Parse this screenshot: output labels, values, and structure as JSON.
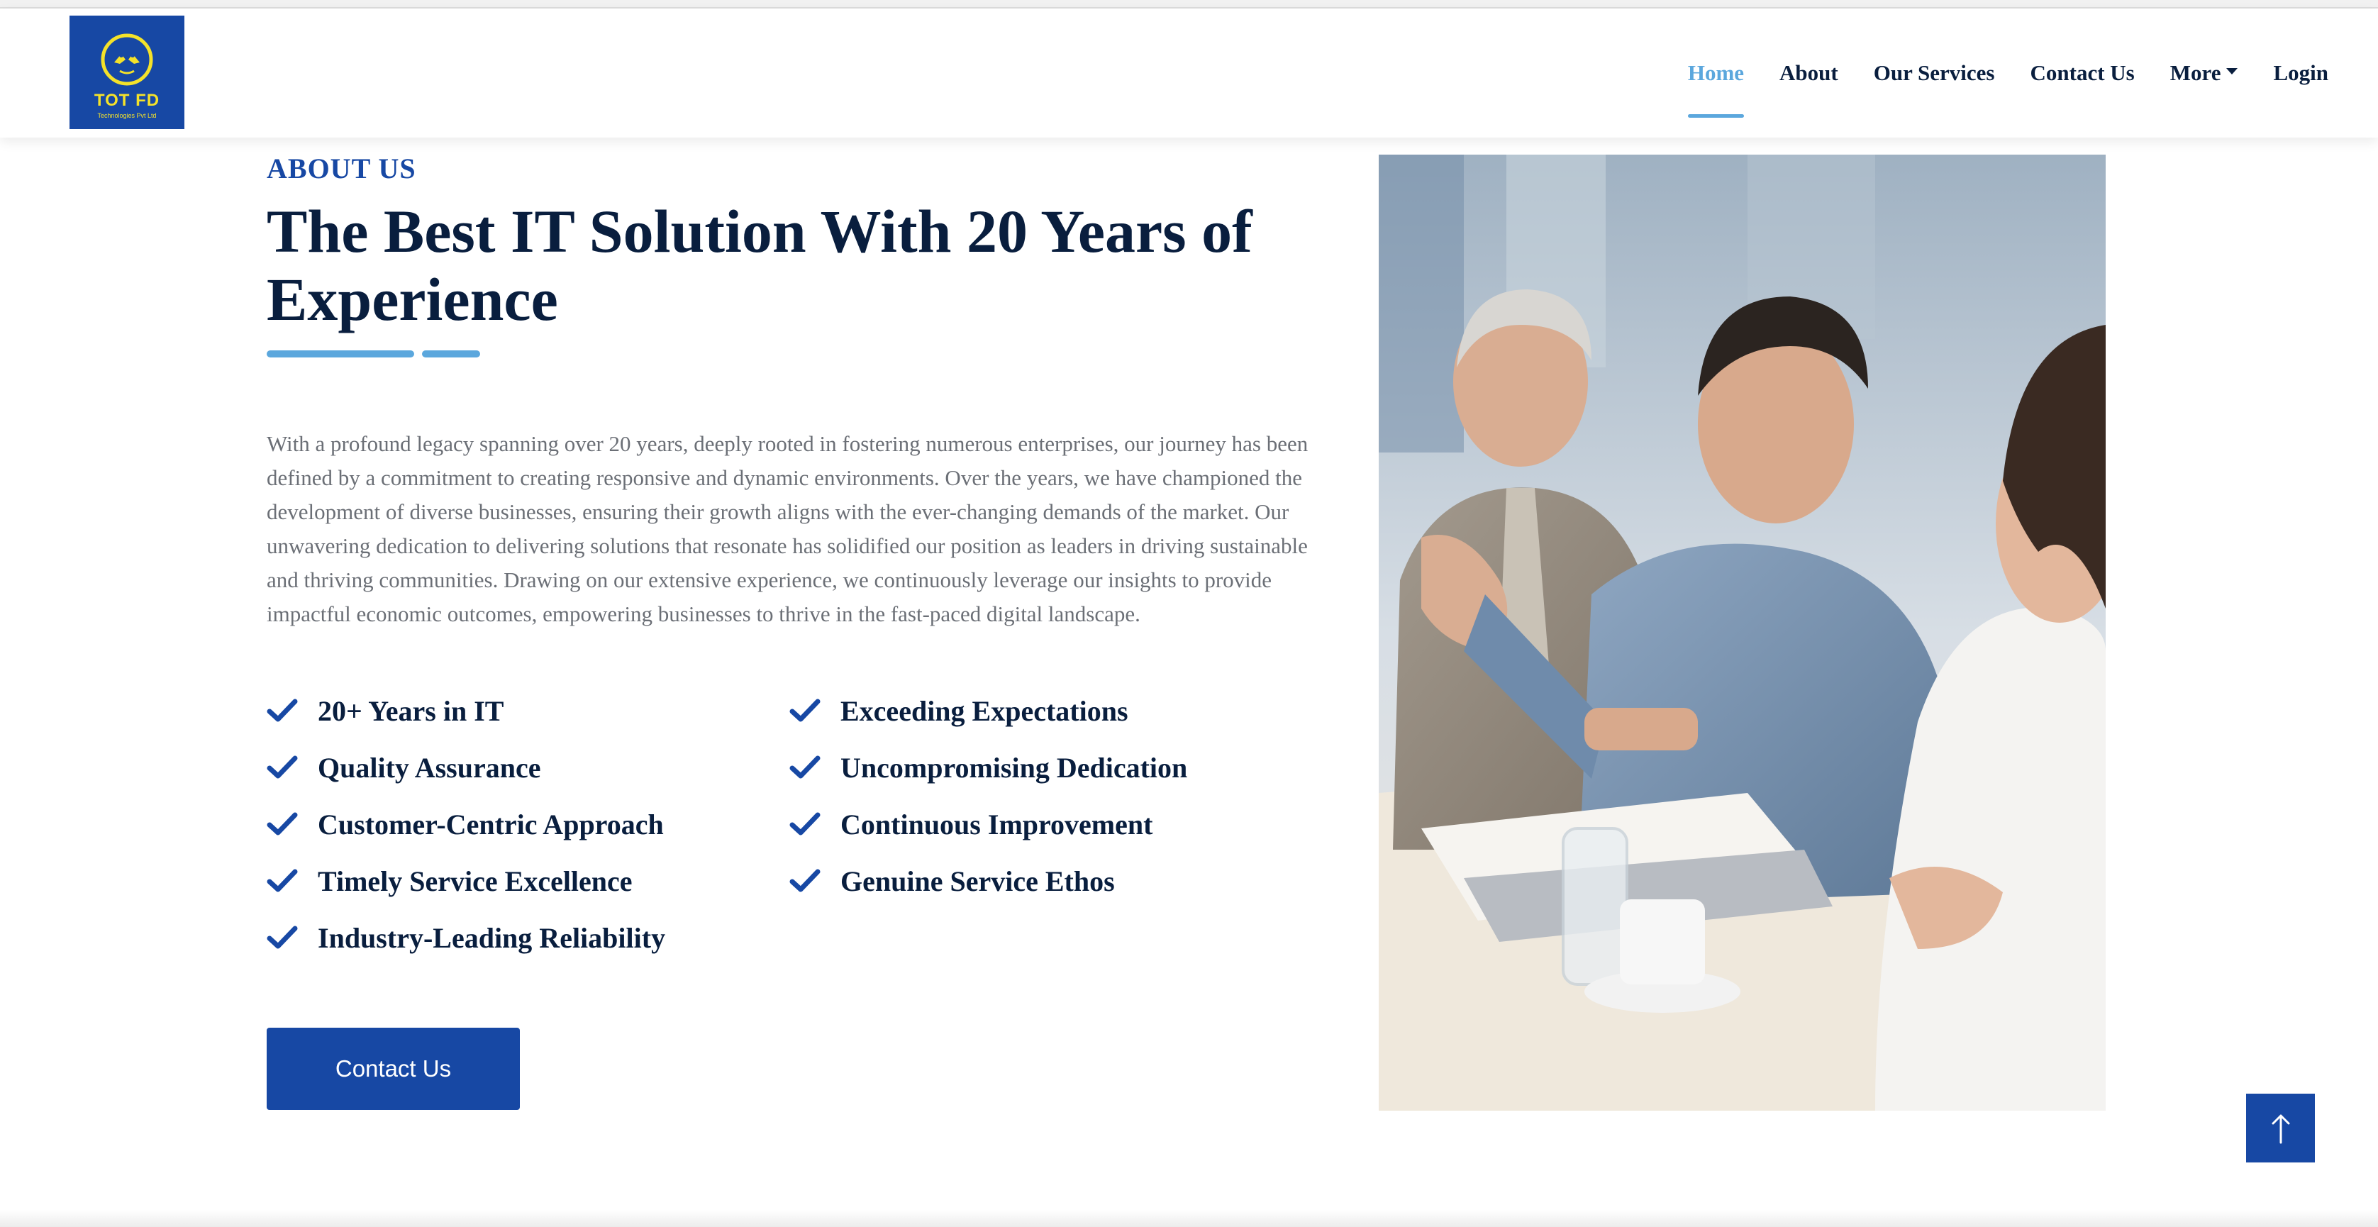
{
  "brand": {
    "name": "TOT FD",
    "tagline": "Technologies Pvt Ltd",
    "logo_bg": "#1748a4",
    "logo_fg": "#f4e22a"
  },
  "nav": {
    "items": [
      {
        "label": "Home",
        "active": true
      },
      {
        "label": "About",
        "active": false
      },
      {
        "label": "Our Services",
        "active": false
      },
      {
        "label": "Contact Us",
        "active": false
      },
      {
        "label": "More",
        "active": false,
        "dropdown": true
      },
      {
        "label": "Login",
        "active": false
      }
    ]
  },
  "about": {
    "label": "ABOUT US",
    "headline": "The Best IT Solution With 20 Years of Experience",
    "paragraph": "With a profound legacy spanning over 20 years, deeply rooted in fostering numerous enterprises, our journey has been defined by a commitment to creating responsive and dynamic environments. Over the years, we have championed the development of diverse businesses, ensuring their growth aligns with the ever-changing demands of the market. Our unwavering dedication to delivering solutions that resonate has solidified our position as leaders in driving sustainable and thriving communities. Drawing on our extensive experience, we continuously leverage our insights to provide impactful economic outcomes, empowering businesses to thrive in the fast-paced digital landscape.",
    "features": [
      "20+ Years in IT",
      "Exceeding Expectations",
      "Quality Assurance",
      "Uncompromising Dedication",
      "Customer-Centric Approach",
      "Continuous Improvement",
      "Timely Service Excellence",
      "Genuine Service Ethos",
      "Industry-Leading Reliability"
    ],
    "cta_label": "Contact Us"
  },
  "icons": {
    "feature": "check-icon",
    "scroll_top": "arrow-up-icon",
    "more": "caret-down-icon"
  },
  "colors": {
    "primary": "#1748a4",
    "accent": "#5ba7dd",
    "heading": "#091e3e",
    "body_text": "#6b6f76"
  }
}
